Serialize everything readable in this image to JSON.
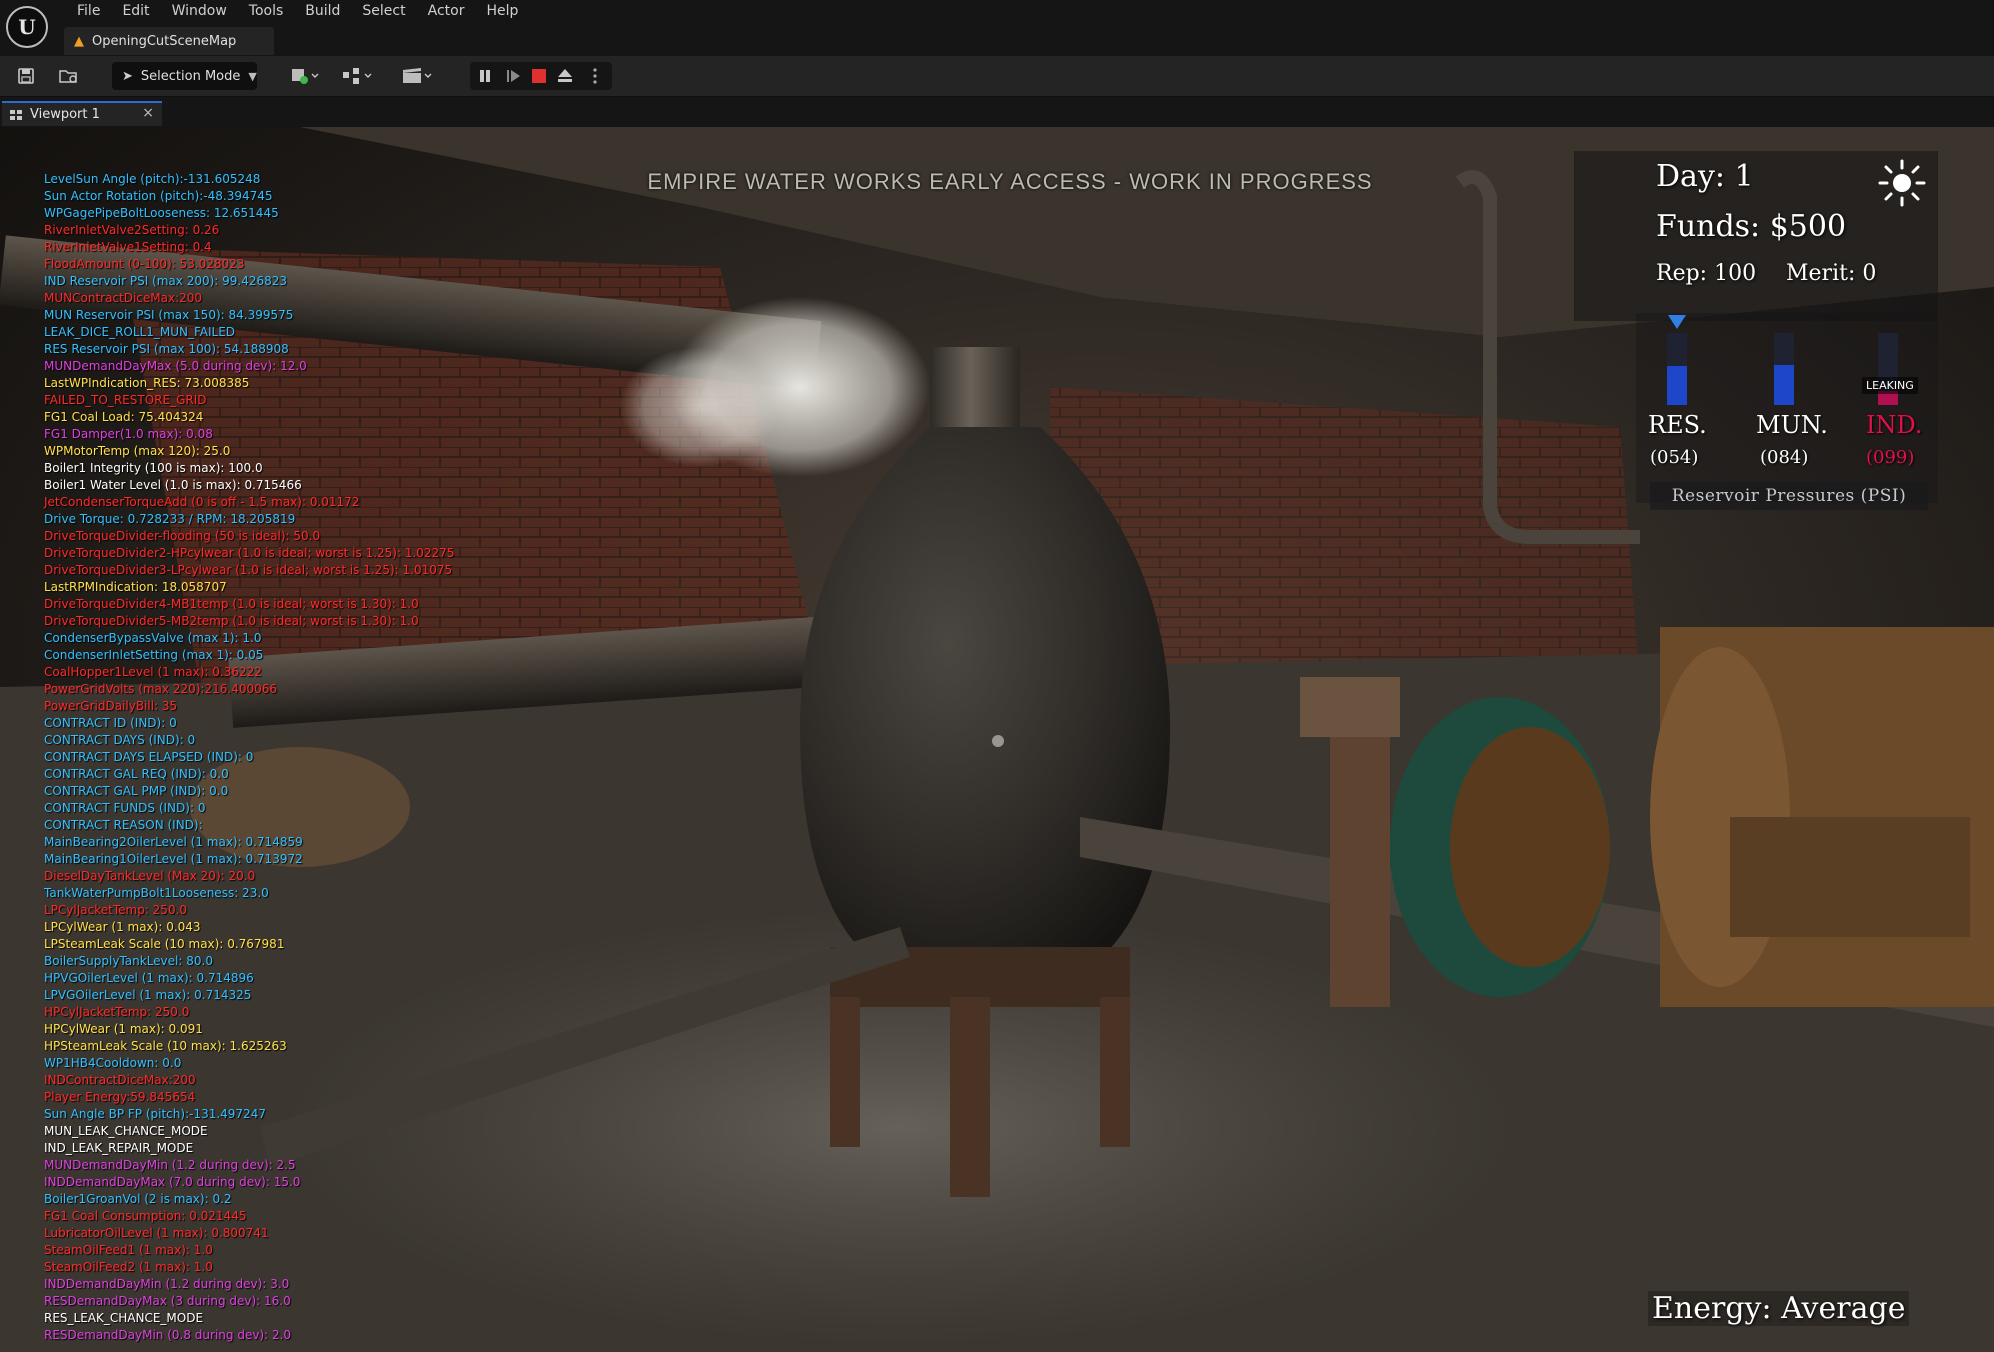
{
  "app": {
    "logo_letter": "U",
    "menu": [
      "File",
      "Edit",
      "Window",
      "Tools",
      "Build",
      "Select",
      "Actor",
      "Help"
    ],
    "map_tab": {
      "label": "OpeningCutSceneMap",
      "warning_icon": "warning-icon"
    }
  },
  "toolbar": {
    "save_icon": "save-icon",
    "browse_icon": "content-browser-icon",
    "selection_mode_label": "Selection Mode",
    "add_icon": "add-actor-icon",
    "blueprint_icon": "blueprint-icon",
    "cinematics_icon": "cinematics-icon",
    "play_controls": [
      "pause-icon",
      "frame-skip-icon",
      "stop-icon",
      "eject-icon",
      "more-options-icon"
    ]
  },
  "viewport_tab": {
    "label": "Viewport 1",
    "close_glyph": "×"
  },
  "game": {
    "banner": "EMPIRE WATER WORKS EARLY ACCESS - WORK IN PROGRESS",
    "day_label": "Day: 1",
    "funds_label": "Funds: $500",
    "rep_label": "Rep: 100",
    "merit_label": "Merit: 0",
    "energy_label": "Energy: Average",
    "pressure_caption": "Reservoir Pressures (PSI)",
    "leaking_label": "LEAKING",
    "reservoirs": [
      {
        "name": "RES.",
        "value": "(054)",
        "level": 0.54,
        "color": "#1d46c9",
        "text_color": "#ffffff"
      },
      {
        "name": "MUN.",
        "value": "(084)",
        "level": 0.56,
        "color": "#1d46c9",
        "text_color": "#ffffff"
      },
      {
        "name": "IND.",
        "value": "(099)",
        "level": 0.2,
        "color": "#b01050",
        "text_color": "#e0104a"
      }
    ],
    "colors": {
      "white": "#ffffff",
      "cyan": "#33c0ff",
      "red": "#ff2a2a",
      "yellow": "#ffe14a",
      "magenta": "#e040e0"
    }
  },
  "debug_lines": [
    {
      "text": "LevelSun Angle (pitch):-131.605248",
      "color": "#33c0ff"
    },
    {
      "text": "Sun Actor Rotation (pitch):-48.394745",
      "color": "#33c0ff"
    },
    {
      "text": "WPGagePipeBoltLooseness: 12.651445",
      "color": "#33c0ff"
    },
    {
      "text": "RiverInletValve2Setting: 0.26",
      "color": "#ff2a2a"
    },
    {
      "text": "RiverInletValve1Setting: 0.4",
      "color": "#ff2a2a"
    },
    {
      "text": "FloodAmount (0-100): 53.028023",
      "color": "#ff2a2a"
    },
    {
      "text": "IND Reservoir PSI (max 200): 99.426823",
      "color": "#33c0ff"
    },
    {
      "text": "MUNContractDiceMax:200",
      "color": "#ff2a2a"
    },
    {
      "text": "MUN Reservoir PSI (max 150): 84.399575",
      "color": "#33c0ff"
    },
    {
      "text": "LEAK_DICE_ROLL1_MUN_FAILED",
      "color": "#33c0ff"
    },
    {
      "text": "RES Reservoir PSI (max 100): 54.188908",
      "color": "#33c0ff"
    },
    {
      "text": "MUNDemandDayMax (5.0 during dev): 12.0",
      "color": "#e040e0"
    },
    {
      "text": "LastWPIndication_RES: 73.008385",
      "color": "#ffe14a"
    },
    {
      "text": "FAILED_TO_RESTORE_GRID",
      "color": "#ff2a2a"
    },
    {
      "text": "FG1 Coal Load: 75.404324",
      "color": "#ffe14a"
    },
    {
      "text": "FG1 Damper(1.0 max): 0.08",
      "color": "#e040e0"
    },
    {
      "text": "WPMotorTemp (max 120): 25.0",
      "color": "#ffe14a"
    },
    {
      "text": "Boiler1 Integrity (100 is max): 100.0",
      "color": "#ffffff"
    },
    {
      "text": "Boiler1 Water Level (1.0 is max): 0.715466",
      "color": "#ffffff"
    },
    {
      "text": "JetCondenserTorqueAdd (0 is off - 1.5 max): 0.01172",
      "color": "#ff2a2a"
    },
    {
      "text": "Drive Torque: 0.728233 / RPM: 18.205819",
      "color": "#33c0ff"
    },
    {
      "text": "DriveTorqueDivider-flooding (50 is ideal): 50.0",
      "color": "#ff2a2a"
    },
    {
      "text": "DriveTorqueDivider2-HPcylwear (1.0 is ideal; worst is 1.25): 1.02275",
      "color": "#ff2a2a"
    },
    {
      "text": "DriveTorqueDivider3-LPcylwear (1.0 is ideal; worst is 1.25): 1.01075",
      "color": "#ff2a2a"
    },
    {
      "text": "LastRPMIndication: 18.058707",
      "color": "#ffe14a"
    },
    {
      "text": "DriveTorqueDivider4-MB1temp (1.0 is ideal; worst is 1.30): 1.0",
      "color": "#ff2a2a"
    },
    {
      "text": "DriveTorqueDivider5-MB2temp (1.0 is ideal; worst is 1.30): 1.0",
      "color": "#ff2a2a"
    },
    {
      "text": "CondenserBypassValve (max 1): 1.0",
      "color": "#33c0ff"
    },
    {
      "text": "CondenserInletSetting (max 1): 0.05",
      "color": "#33c0ff"
    },
    {
      "text": "CoalHopper1Level (1 max): 0.36222",
      "color": "#ff2a2a"
    },
    {
      "text": "PowerGridVolts (max 220):216.400066",
      "color": "#ff2a2a"
    },
    {
      "text": "PowerGridDailyBill: 35",
      "color": "#ff2a2a"
    },
    {
      "text": "CONTRACT ID (IND): 0",
      "color": "#33c0ff"
    },
    {
      "text": "CONTRACT DAYS (IND): 0",
      "color": "#33c0ff"
    },
    {
      "text": "CONTRACT DAYS ELAPSED (IND): 0",
      "color": "#33c0ff"
    },
    {
      "text": "CONTRACT GAL REQ (IND): 0.0",
      "color": "#33c0ff"
    },
    {
      "text": "CONTRACT GAL PMP (IND): 0.0",
      "color": "#33c0ff"
    },
    {
      "text": "CONTRACT FUNDS (IND): 0",
      "color": "#33c0ff"
    },
    {
      "text": "CONTRACT REASON (IND):",
      "color": "#33c0ff"
    },
    {
      "text": "MainBearing2OilerLevel (1 max): 0.714859",
      "color": "#33c0ff"
    },
    {
      "text": "MainBearing1OilerLevel (1 max): 0.713972",
      "color": "#33c0ff"
    },
    {
      "text": "DieselDayTankLevel (Max 20): 20.0",
      "color": "#ff2a2a"
    },
    {
      "text": "TankWaterPumpBolt1Looseness: 23.0",
      "color": "#33c0ff"
    },
    {
      "text": "LPCylJacketTemp: 250.0",
      "color": "#ff2a2a"
    },
    {
      "text": "LPCylWear (1 max): 0.043",
      "color": "#ffe14a"
    },
    {
      "text": "LPSteamLeak Scale (10 max): 0.767981",
      "color": "#ffe14a"
    },
    {
      "text": "BoilerSupplyTankLevel: 80.0",
      "color": "#33c0ff"
    },
    {
      "text": "HPVGOilerLevel (1 max): 0.714896",
      "color": "#33c0ff"
    },
    {
      "text": "LPVGOilerLevel (1 max): 0.714325",
      "color": "#33c0ff"
    },
    {
      "text": "HPCylJacketTemp: 250.0",
      "color": "#ff2a2a"
    },
    {
      "text": "HPCylWear (1 max): 0.091",
      "color": "#ffe14a"
    },
    {
      "text": "HPSteamLeak Scale (10 max): 1.625263",
      "color": "#ffe14a"
    },
    {
      "text": "WP1HB4Cooldown: 0.0",
      "color": "#33c0ff"
    },
    {
      "text": "INDContractDiceMax:200",
      "color": "#ff2a2a"
    },
    {
      "text": "Player Energy:59.845654",
      "color": "#ff2a2a"
    },
    {
      "text": "Sun Angle BP FP (pitch):-131.497247",
      "color": "#33c0ff"
    },
    {
      "text": "MUN_LEAK_CHANCE_MODE",
      "color": "#ffffff"
    },
    {
      "text": "IND_LEAK_REPAIR_MODE",
      "color": "#ffffff"
    },
    {
      "text": "MUNDemandDayMin (1.2 during dev): 2.5",
      "color": "#e040e0"
    },
    {
      "text": "INDDemandDayMax (7.0 during dev): 15.0",
      "color": "#e040e0"
    },
    {
      "text": "Boiler1GroanVol (2 is max): 0.2",
      "color": "#33c0ff"
    },
    {
      "text": "FG1 Coal Consumption: 0.021445",
      "color": "#ff2a2a"
    },
    {
      "text": "LubricatorOilLevel (1 max): 0.800741",
      "color": "#ff2a2a"
    },
    {
      "text": "SteamOilFeed1 (1 max): 1.0",
      "color": "#ff2a2a"
    },
    {
      "text": "SteamOilFeed2 (1 max): 1.0",
      "color": "#ff2a2a"
    },
    {
      "text": "INDDemandDayMin (1.2 during dev): 3.0",
      "color": "#e040e0"
    },
    {
      "text": "RESDemandDayMax (3 during dev): 16.0",
      "color": "#e040e0"
    },
    {
      "text": "RES_LEAK_CHANCE_MODE",
      "color": "#ffffff"
    },
    {
      "text": "RESDemandDayMin (0.8 during dev): 2.0",
      "color": "#e040e0"
    }
  ]
}
